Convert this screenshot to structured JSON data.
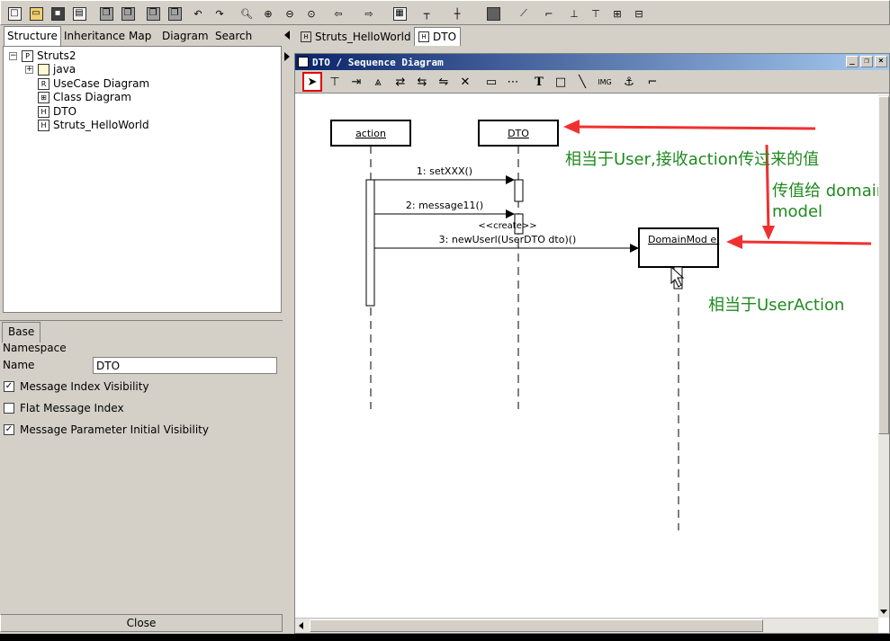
{
  "left_panel": {
    "tabs": [
      "Structure",
      "Inheritance",
      "Map",
      "Diagram",
      "Search"
    ],
    "tree": {
      "root": "Struts2",
      "children": [
        "java",
        "UseCase Diagram",
        "Class Diagram",
        "DTO",
        "Struts_HelloWorld"
      ]
    }
  },
  "properties": {
    "tab": "Base",
    "namespace_label": "Namespace",
    "name_label": "Name",
    "name_value": "DTO",
    "options": [
      {
        "label": "Message Index Visibility",
        "checked": true
      },
      {
        "label": "Flat Message Index",
        "checked": false
      },
      {
        "label": "Message Parameter Initial Visibility",
        "checked": true
      }
    ],
    "close_label": "Close"
  },
  "doc_tabs": [
    "Struts_HelloWorld",
    "DTO"
  ],
  "diagram_window": {
    "title": "DTO / Sequence Diagram"
  },
  "sequence": {
    "lifelines": [
      "action",
      "DTO",
      "DomainMod el"
    ],
    "messages": [
      "1: setXXX()",
      "2: message11()",
      "3: newUserl(UserDTO dto)()"
    ],
    "stereotype": "<<create>>"
  },
  "annotations": {
    "dto_note": "相当于User,接收action传过来的值",
    "pass_note": "传值给 domainmodel",
    "useraction_note": "相当于UserAction",
    "color": "#1f8a1f",
    "arrow_color": "#f03030"
  }
}
